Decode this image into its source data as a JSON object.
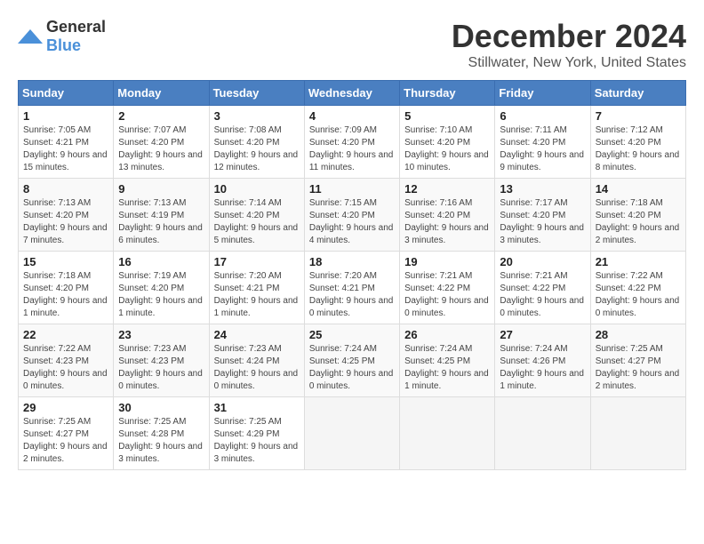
{
  "logo": {
    "general": "General",
    "blue": "Blue"
  },
  "title": "December 2024",
  "subtitle": "Stillwater, New York, United States",
  "days_of_week": [
    "Sunday",
    "Monday",
    "Tuesday",
    "Wednesday",
    "Thursday",
    "Friday",
    "Saturday"
  ],
  "weeks": [
    [
      {
        "day": "1",
        "sunrise": "Sunrise: 7:05 AM",
        "sunset": "Sunset: 4:21 PM",
        "daylight": "Daylight: 9 hours and 15 minutes."
      },
      {
        "day": "2",
        "sunrise": "Sunrise: 7:07 AM",
        "sunset": "Sunset: 4:20 PM",
        "daylight": "Daylight: 9 hours and 13 minutes."
      },
      {
        "day": "3",
        "sunrise": "Sunrise: 7:08 AM",
        "sunset": "Sunset: 4:20 PM",
        "daylight": "Daylight: 9 hours and 12 minutes."
      },
      {
        "day": "4",
        "sunrise": "Sunrise: 7:09 AM",
        "sunset": "Sunset: 4:20 PM",
        "daylight": "Daylight: 9 hours and 11 minutes."
      },
      {
        "day": "5",
        "sunrise": "Sunrise: 7:10 AM",
        "sunset": "Sunset: 4:20 PM",
        "daylight": "Daylight: 9 hours and 10 minutes."
      },
      {
        "day": "6",
        "sunrise": "Sunrise: 7:11 AM",
        "sunset": "Sunset: 4:20 PM",
        "daylight": "Daylight: 9 hours and 9 minutes."
      },
      {
        "day": "7",
        "sunrise": "Sunrise: 7:12 AM",
        "sunset": "Sunset: 4:20 PM",
        "daylight": "Daylight: 9 hours and 8 minutes."
      }
    ],
    [
      {
        "day": "8",
        "sunrise": "Sunrise: 7:13 AM",
        "sunset": "Sunset: 4:20 PM",
        "daylight": "Daylight: 9 hours and 7 minutes."
      },
      {
        "day": "9",
        "sunrise": "Sunrise: 7:13 AM",
        "sunset": "Sunset: 4:19 PM",
        "daylight": "Daylight: 9 hours and 6 minutes."
      },
      {
        "day": "10",
        "sunrise": "Sunrise: 7:14 AM",
        "sunset": "Sunset: 4:20 PM",
        "daylight": "Daylight: 9 hours and 5 minutes."
      },
      {
        "day": "11",
        "sunrise": "Sunrise: 7:15 AM",
        "sunset": "Sunset: 4:20 PM",
        "daylight": "Daylight: 9 hours and 4 minutes."
      },
      {
        "day": "12",
        "sunrise": "Sunrise: 7:16 AM",
        "sunset": "Sunset: 4:20 PM",
        "daylight": "Daylight: 9 hours and 3 minutes."
      },
      {
        "day": "13",
        "sunrise": "Sunrise: 7:17 AM",
        "sunset": "Sunset: 4:20 PM",
        "daylight": "Daylight: 9 hours and 3 minutes."
      },
      {
        "day": "14",
        "sunrise": "Sunrise: 7:18 AM",
        "sunset": "Sunset: 4:20 PM",
        "daylight": "Daylight: 9 hours and 2 minutes."
      }
    ],
    [
      {
        "day": "15",
        "sunrise": "Sunrise: 7:18 AM",
        "sunset": "Sunset: 4:20 PM",
        "daylight": "Daylight: 9 hours and 1 minute."
      },
      {
        "day": "16",
        "sunrise": "Sunrise: 7:19 AM",
        "sunset": "Sunset: 4:20 PM",
        "daylight": "Daylight: 9 hours and 1 minute."
      },
      {
        "day": "17",
        "sunrise": "Sunrise: 7:20 AM",
        "sunset": "Sunset: 4:21 PM",
        "daylight": "Daylight: 9 hours and 1 minute."
      },
      {
        "day": "18",
        "sunrise": "Sunrise: 7:20 AM",
        "sunset": "Sunset: 4:21 PM",
        "daylight": "Daylight: 9 hours and 0 minutes."
      },
      {
        "day": "19",
        "sunrise": "Sunrise: 7:21 AM",
        "sunset": "Sunset: 4:22 PM",
        "daylight": "Daylight: 9 hours and 0 minutes."
      },
      {
        "day": "20",
        "sunrise": "Sunrise: 7:21 AM",
        "sunset": "Sunset: 4:22 PM",
        "daylight": "Daylight: 9 hours and 0 minutes."
      },
      {
        "day": "21",
        "sunrise": "Sunrise: 7:22 AM",
        "sunset": "Sunset: 4:22 PM",
        "daylight": "Daylight: 9 hours and 0 minutes."
      }
    ],
    [
      {
        "day": "22",
        "sunrise": "Sunrise: 7:22 AM",
        "sunset": "Sunset: 4:23 PM",
        "daylight": "Daylight: 9 hours and 0 minutes."
      },
      {
        "day": "23",
        "sunrise": "Sunrise: 7:23 AM",
        "sunset": "Sunset: 4:23 PM",
        "daylight": "Daylight: 9 hours and 0 minutes."
      },
      {
        "day": "24",
        "sunrise": "Sunrise: 7:23 AM",
        "sunset": "Sunset: 4:24 PM",
        "daylight": "Daylight: 9 hours and 0 minutes."
      },
      {
        "day": "25",
        "sunrise": "Sunrise: 7:24 AM",
        "sunset": "Sunset: 4:25 PM",
        "daylight": "Daylight: 9 hours and 0 minutes."
      },
      {
        "day": "26",
        "sunrise": "Sunrise: 7:24 AM",
        "sunset": "Sunset: 4:25 PM",
        "daylight": "Daylight: 9 hours and 1 minute."
      },
      {
        "day": "27",
        "sunrise": "Sunrise: 7:24 AM",
        "sunset": "Sunset: 4:26 PM",
        "daylight": "Daylight: 9 hours and 1 minute."
      },
      {
        "day": "28",
        "sunrise": "Sunrise: 7:25 AM",
        "sunset": "Sunset: 4:27 PM",
        "daylight": "Daylight: 9 hours and 2 minutes."
      }
    ],
    [
      {
        "day": "29",
        "sunrise": "Sunrise: 7:25 AM",
        "sunset": "Sunset: 4:27 PM",
        "daylight": "Daylight: 9 hours and 2 minutes."
      },
      {
        "day": "30",
        "sunrise": "Sunrise: 7:25 AM",
        "sunset": "Sunset: 4:28 PM",
        "daylight": "Daylight: 9 hours and 3 minutes."
      },
      {
        "day": "31",
        "sunrise": "Sunrise: 7:25 AM",
        "sunset": "Sunset: 4:29 PM",
        "daylight": "Daylight: 9 hours and 3 minutes."
      },
      null,
      null,
      null,
      null
    ]
  ]
}
